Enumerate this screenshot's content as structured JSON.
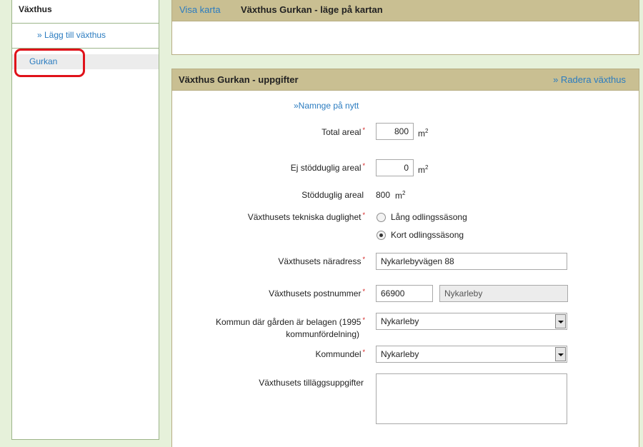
{
  "sidebar": {
    "title": "Växthus",
    "add_link": "» Lägg till växthus",
    "items": [
      {
        "label": "Gurkan"
      }
    ]
  },
  "map_panel": {
    "show_map_link": "Visa karta",
    "title": "Växthus Gurkan - läge på kartan"
  },
  "details_panel": {
    "title": "Växthus Gurkan - uppgifter",
    "delete_link": "» Radera växthus",
    "rename_link": "»Namnge på nytt"
  },
  "form": {
    "total_area": {
      "label": "Total areal",
      "value": "800",
      "unit": "m",
      "unit_sup": "2"
    },
    "ineligible_area": {
      "label": "Ej stödduglig areal",
      "value": "0",
      "unit": "m",
      "unit_sup": "2"
    },
    "eligible_area": {
      "label": "Stödduglig areal",
      "value": "800",
      "unit": "m",
      "unit_sup": "2"
    },
    "technical": {
      "label": "Växthusets tekniska duglighet",
      "options": [
        {
          "label": "Lång odlingssäsong",
          "selected": false
        },
        {
          "label": "Kort odlingssäsong",
          "selected": true
        }
      ]
    },
    "address": {
      "label": "Växthusets näradress",
      "value": "Nykarlebyvägen 88"
    },
    "postcode": {
      "label": "Växthusets postnummer",
      "value": "66900",
      "city": "Nykarleby"
    },
    "municipality": {
      "label_line1": "Kommun där gården är belagen (1995",
      "label_line2": "kommunfördelning)",
      "value": "Nykarleby"
    },
    "municipal_part": {
      "label": "Kommundel",
      "value": "Nykarleby"
    },
    "additional": {
      "label": "Växthusets tilläggsuppgifter",
      "value": ""
    }
  },
  "colors": {
    "background": "#e6f1da",
    "panel_header": "#c9bf92",
    "link": "#2b7cc0",
    "required": "#d21818",
    "highlight": "#e0121a"
  }
}
